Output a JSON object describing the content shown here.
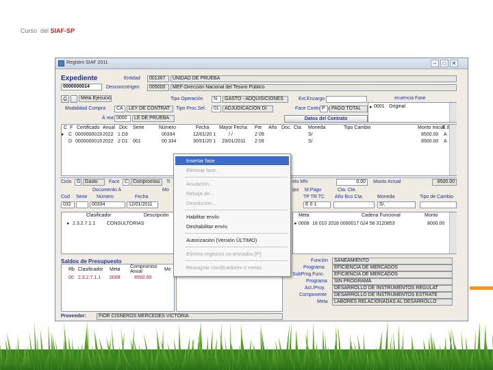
{
  "slide": {
    "header_prefix": "Curso  del ",
    "header_brand": "SIAF-SP"
  },
  "window": {
    "title": "Registro SIAF 2011",
    "buttons": [
      "–",
      "□",
      "✕"
    ]
  },
  "expediente": {
    "title": "Expediente",
    "number": "0000000014",
    "entidad_label": "Entidad",
    "entidad_code": "001367",
    "entidad_name": "UNIDAD DE PRUEBA",
    "desconc_label": "Desconcntrigen",
    "desconc_code": "005000",
    "desconc_name": "MEF-Dirección Nacional del Tesoro Público",
    "meta_label": "Meta Ejecución",
    "tipo_op_label": "Tipo Operación",
    "tipo_op_code": "N",
    "tipo_op_name": "GASTO - ADQUISICIONES",
    "ext_encargo_label": "Ext.Encargo",
    "secuencia_label": "ecuencia Fase",
    "modalidad_label": "Modalidad Compra",
    "modalidad_code": "CA",
    "modalidad_name": "LEY DE CONTRAT",
    "tipo_proc_label": "Tipo Proc.Sel.",
    "tipo_proc_code": "01",
    "tipo_proc_name": "ADJUDICACION DI",
    "fase_contractual_label": "Face Contractual",
    "fase_contractual_code": "P",
    "fase_contractual_name": "PAGO TOTAL",
    "area_label": "Á rea",
    "area_code": "0000",
    "area_name": "LE DE PRUEBA",
    "datos_contrato": "Datos del Contrato",
    "secuencia_first": "0001",
    "secuencia_first_name": "Original"
  },
  "grid": {
    "headers": [
      "C",
      "F",
      "Certificado",
      "Anual",
      "Doc",
      "Serie",
      "Número",
      "Fecha",
      "Mayor Fecha",
      "Fte",
      "Año",
      "Doc.",
      "Cta",
      "Moneda",
      "Tipo Cambio",
      "Monto Inicial",
      "E.",
      "E."
    ],
    "rows": [
      {
        "c": "C",
        "cert": "0000000019",
        "anual": "2022",
        "doc": "1 D3",
        "serie": "",
        "num": "00334",
        "fecha": "12/01/20 1",
        "mayor": "/ /",
        "fte": "2 09",
        "moneda": "S/",
        "monto": "8500.00",
        "e": "A"
      },
      {
        "c": "D",
        "cert": "0000000019",
        "anual": "2022",
        "doc": "2 D1",
        "serie": "001",
        "num": "00 334",
        "fecha": "30/01/20 1",
        "mayor": "23/01/2011",
        "fte": "2 09",
        "moneda": "S/",
        "monto": "8500.00",
        "e": "A"
      }
    ]
  },
  "mid": {
    "ciclo_label": "Ciclo",
    "ciclo_code": "G",
    "ciclo_name": "Gasto",
    "fase_label": "Face",
    "fase_code": "C",
    "fase_name": "Compromiso",
    "tipo_label": "Ti",
    "nto_mn_label": "elo MN",
    "nto_mn_value": "0.00",
    "monto_actual_label": "Monto Actual",
    "monto_actual_value": "8500.00",
    "documento_label": "Documento A",
    "mo_label": "Mo",
    "cod_label": "Cod",
    "serie_label": "Serie",
    "numero_label": "Número",
    "fecha_label": "Fecha",
    "cod_value": "032",
    "numero_value": "00334",
    "fecha_value": "12/01/2011",
    "tipo_pago_label": "ipo",
    "m_pago_label": "M.Pago",
    "cta_cte_label": "Cta. Cte.",
    "tp_labels": "TP TR TC",
    "ano_bco_label": "Año  Bco  Cta.",
    "moneda_label": "Moneda",
    "tipo_cambio_label": "Tipo de Cambio",
    "tp_values": "E  0  1",
    "moneda_value": "S/."
  },
  "clasif": {
    "header_clasificador": "Clasificador",
    "header_descripcion": "Descripción",
    "row_code": "2.3.2.7.1.1",
    "row_desc": "CONSULTORIAS"
  },
  "meta_grid": {
    "header_meta": "Meta",
    "header_cadena": "Cadena Funcional",
    "header_monto": "Monto",
    "row_meta": "0008",
    "row_cadena": "18 010 2018 0000017 024 56 3120853",
    "row_monto": "8000.00"
  },
  "saldos": {
    "title": "Saldos de Presupuesto",
    "col_rb": "Rb",
    "col_clasificador": "Clasificador",
    "col_meta": "Meta",
    "col_compromiso": "Compromiso Anual",
    "col_mo": "Mo",
    "row_rb": "00",
    "row_clasif": "2.3.2.7.1.1",
    "row_meta": "0008",
    "row_comp": "8500.00"
  },
  "funcional": {
    "labels": [
      "Función",
      "Programa",
      "SubProg.Func.",
      "Programa",
      "Act./Proy.",
      "Componente",
      "Meta"
    ],
    "values": [
      "SANEAMIENTO",
      "EFICIENCIA DE MERCADOS",
      "EFICIENCIA DE MERCADOS",
      "SIN PROGRAMA",
      "DESARROLLO DE INSTRUMENTOS REGULAT",
      "DESARROLLO DE INSTRUMENTOS ESTRATÉ",
      "LABORES RELACIONADAS AL DESARROLLO"
    ]
  },
  "proveedor": {
    "label": "Proveedor:",
    "value": "FIOR CISNEROS MERCEDES VICTORIA"
  },
  "context_menu": {
    "items": [
      {
        "label": "Insertar fase",
        "state": "selected"
      },
      {
        "label": "Eliminar fase",
        "state": "disabled"
      },
      {
        "label": "Anulación...",
        "state": "disabled"
      },
      {
        "label": "Rebaja de...",
        "state": "disabled"
      },
      {
        "label": "Devolución...",
        "state": "disabled"
      },
      {
        "label": "Habilitar envío",
        "state": "enabled"
      },
      {
        "label": "Deshabilitar envío",
        "state": "enabled"
      },
      {
        "label": "Autorización (Versión ÚLTIMO)",
        "state": "enabled"
      },
      {
        "label": "Elimina registros no enviados [P]",
        "state": "disabled"
      },
      {
        "label": "Reasignar clasificadores o metas",
        "state": "disabled"
      }
    ]
  },
  "colors": {
    "accent_blue": "#1d2f9a",
    "menu_highlight": "#3d6bc8",
    "brand_red": "#d02020",
    "orange_bar": "#f39a1e",
    "grass_green": "#3e8d22"
  }
}
